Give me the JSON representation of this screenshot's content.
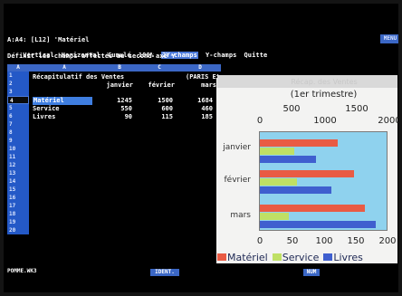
{
  "app": {
    "cell_ref_line": "A:A4: [L12] 'Matériel",
    "menu_items": [
      "Vertical",
      "Horizontal",
      "Cumulé",
      "100%",
      "2Y-champs",
      "Y-champs",
      "Quitte"
    ],
    "active_menu": "2Y-champs",
    "help_line": "Définit les champs affectés au second axe Y",
    "mode_indicator": "MENU",
    "status_file": "POMME.WK3",
    "status_mid": "IDENT.",
    "status_right": "NUM"
  },
  "sheet": {
    "column_headers": [
      "A",
      "A",
      "B",
      "C",
      "D"
    ],
    "row_numbers": [
      "1",
      "2",
      "3",
      "4",
      "5",
      "6",
      "7",
      "8",
      "9",
      "10",
      "11",
      "12",
      "13",
      "14",
      "15",
      "16",
      "17",
      "18",
      "19",
      "20"
    ],
    "selected_row": "4",
    "cells": {
      "a1": "Récapitulatif des Ventes",
      "d1": "(PARIS Et",
      "b2": "janvier",
      "c2": "février",
      "d2": "mars",
      "a4": "Matériel",
      "a5": "Service",
      "a6": "Livres",
      "b4": "1245",
      "c4": "1500",
      "d4": "1684",
      "b5": "550",
      "c5": "600",
      "d5": "460",
      "b6": "90",
      "c6": "115",
      "d6": "185"
    }
  },
  "chart_data": {
    "type": "bar",
    "title": "Récap. des Ventes",
    "subtitle": "(1er trimestre)",
    "categories": [
      "janvier",
      "février",
      "mars"
    ],
    "series": [
      {
        "name": "Matériel",
        "values": [
          1245,
          1500,
          1684
        ],
        "color": "#e95b44",
        "axis": "top"
      },
      {
        "name": "Service",
        "values": [
          550,
          600,
          460
        ],
        "color": "#bfe065",
        "axis": "top"
      },
      {
        "name": "Livres",
        "values": [
          90,
          115,
          185
        ],
        "color": "#3f5fcf",
        "axis": "bottom"
      }
    ],
    "top_axis_1": [
      "500",
      "1500"
    ],
    "top_axis_2": [
      "0",
      "1000",
      "2000"
    ],
    "bottom_axis": [
      "0",
      "50",
      "100",
      "150",
      "200"
    ],
    "top_axis_range": [
      0,
      2000
    ],
    "bottom_axis_range": [
      0,
      200
    ],
    "legend": [
      "Matériel",
      "Service",
      "Livres"
    ]
  }
}
